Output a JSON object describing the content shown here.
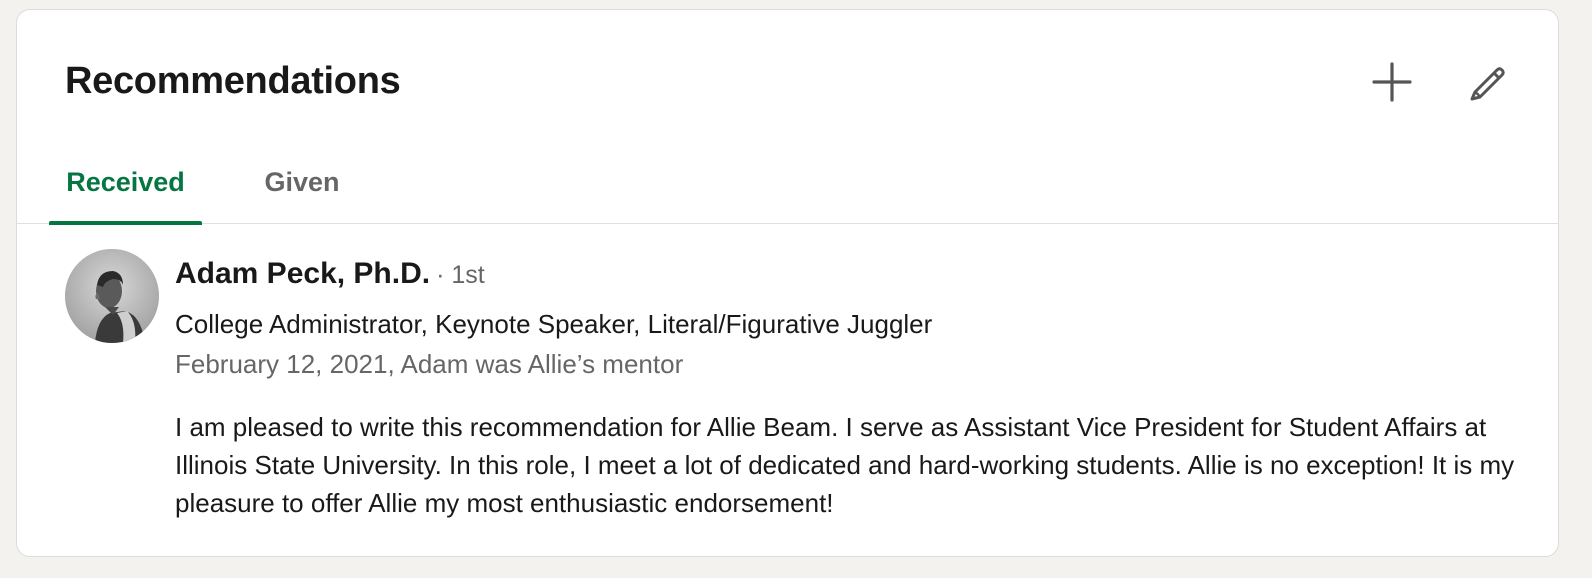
{
  "section": {
    "title": "Recommendations",
    "add_icon": "plus-icon",
    "edit_icon": "pencil-icon"
  },
  "tabs": [
    {
      "label": "Received",
      "active": true
    },
    {
      "label": "Given",
      "active": false
    }
  ],
  "recommendation": {
    "name": "Adam Peck, Ph.D.",
    "degree": "· 1st",
    "headline": "College Administrator, Keynote Speaker, Literal/Figurative Juggler",
    "meta": "February 12, 2021, Adam was Allie’s mentor",
    "body": "I am pleased to write this recommendation for Allie Beam. I serve as Assistant Vice President for Student Affairs at Illinois State University. In this role, I meet a lot of dedicated and hard-working students. Allie is no exception! It is my pleasure to offer Allie my most enthusiastic endorsement!",
    "avatar_icon": "profile-photo"
  },
  "colors": {
    "accent": "#057642",
    "text_primary": "#191919",
    "text_secondary": "#666666",
    "background": "#f3f2ef",
    "card": "#ffffff"
  }
}
